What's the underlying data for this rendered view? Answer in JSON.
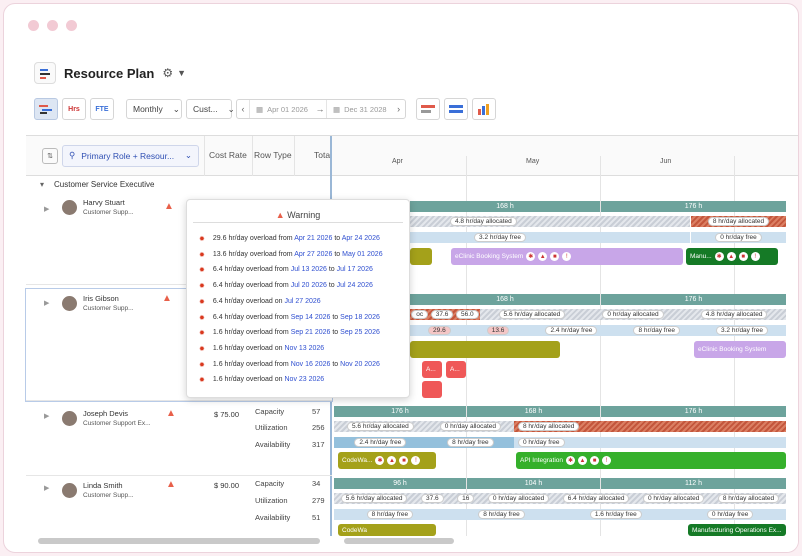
{
  "app": {
    "title": "Resource Plan"
  },
  "toolbar": {
    "view_btn_hrs": "Hrs",
    "view_btn_fte": "FTE",
    "scale": "Monthly",
    "custom": "Cust...",
    "date_from": "Apr 01 2026",
    "date_to": "Dec 31 2028"
  },
  "grid": {
    "filter_label": "Primary Role + Resour...",
    "cost_rate_header": "Cost Rate",
    "row_type_header": "Row Type",
    "total_header": "Tota",
    "months": [
      "Apr",
      "May",
      "Jun"
    ],
    "group": "Customer Service Executive"
  },
  "people": [
    {
      "name": "Harvy Stuart",
      "role": "Customer Supp..."
    },
    {
      "name": "Iris Gibson",
      "role": "Customer Supp..."
    },
    {
      "name": "Joseph Devis",
      "role": "Customer Support Ex...",
      "cost": "$ 75.00",
      "rows": [
        {
          "type": "Capacity",
          "total": "57"
        },
        {
          "type": "Utilization",
          "total": "256"
        },
        {
          "type": "Availability",
          "total": "317"
        }
      ]
    },
    {
      "name": "Linda Smith",
      "role": "Customer Supp...",
      "cost": "$ 90.00",
      "rows": [
        {
          "type": "Capacity",
          "total": "34"
        },
        {
          "type": "Utilization",
          "total": "279"
        },
        {
          "type": "Availability",
          "total": "51"
        }
      ]
    }
  ],
  "warning": {
    "title": "Warning",
    "lines": [
      {
        "text": "29.6 hr/day overload from",
        "a": "Apr 21 2026",
        "mid": "to",
        "b": "Apr 24 2026"
      },
      {
        "text": "13.6 hr/day overload from",
        "a": "Apr 27 2026",
        "mid": "to",
        "b": "May 01 2026"
      },
      {
        "text": "6.4 hr/day overload from",
        "a": "Jul 13 2026",
        "mid": "to",
        "b": "Jul 17 2026"
      },
      {
        "text": "6.4 hr/day overload from",
        "a": "Jul 20 2026",
        "mid": "to",
        "b": "Jul 24 2026"
      },
      {
        "text": "6.4 hr/day overload on",
        "a": "Jul 27 2026",
        "mid": "",
        "b": ""
      },
      {
        "text": "6.4 hr/day overload from",
        "a": "Sep 14 2026",
        "mid": "to",
        "b": "Sep 18 2026"
      },
      {
        "text": "1.6 hr/day overload from",
        "a": "Sep 21 2026",
        "mid": "to",
        "b": "Sep 25 2026"
      },
      {
        "text": "1.6 hr/day overload on",
        "a": "Nov 13 2026",
        "mid": "",
        "b": ""
      },
      {
        "text": "1.6 hr/day overload from",
        "a": "Nov 16 2026",
        "mid": "to",
        "b": "Nov 20 2026"
      },
      {
        "text": "1.6 hr/day overload on",
        "a": "Nov 23 2026",
        "mid": "",
        "b": ""
      }
    ]
  },
  "gantt": {
    "harvy": {
      "cap": [
        "168 h",
        "176 h"
      ],
      "util": [
        "4.8 hr/day allocated",
        "8 hr/day allocated"
      ],
      "avail": [
        "3.2 hr/day free",
        "0 hr/day free"
      ],
      "tasks": [
        "eClinic Booking System",
        "Manu..."
      ]
    },
    "iris": {
      "cap": [
        "168 h",
        "176 h"
      ],
      "util": [
        "37.6",
        "56.0",
        "5.6 hr/day allocated",
        "0 hr/day allocated",
        "4.8 hr/day allocated",
        "oc"
      ],
      "avail": [
        "29.6",
        "13.6",
        "2.4 hr/day free",
        "8 hr/day free",
        "3.2 hr/day free"
      ],
      "tasks": [
        "eClinic Booking System",
        "A...",
        "A..."
      ]
    },
    "joseph": {
      "cap": [
        "176 h",
        "168 h",
        "176 h"
      ],
      "util": [
        "5.6 hr/day allocated",
        "0 hr/day allocated",
        "8 hr/day allocated"
      ],
      "avail": [
        "2.4 hr/day free",
        "8 hr/day free",
        "0 hr/day free"
      ],
      "tasks": [
        "CodeWa...",
        "API Integration"
      ]
    },
    "linda": {
      "cap": [
        "96 h",
        "104 h",
        "112 h"
      ],
      "util": [
        "5.6 hr/day allocated",
        "37.6",
        "16",
        "0 hr/day allocated",
        "6.4 hr/day allocated",
        "0 hr/day allocated",
        "8 hr/day allocated"
      ],
      "avail": [
        "8 hr/day free",
        "8 hr/day free",
        "1.6 hr/day free",
        "0 hr/day free"
      ],
      "tasks": [
        "CodeWa",
        "Manufacturing Operations Ex..."
      ]
    }
  }
}
